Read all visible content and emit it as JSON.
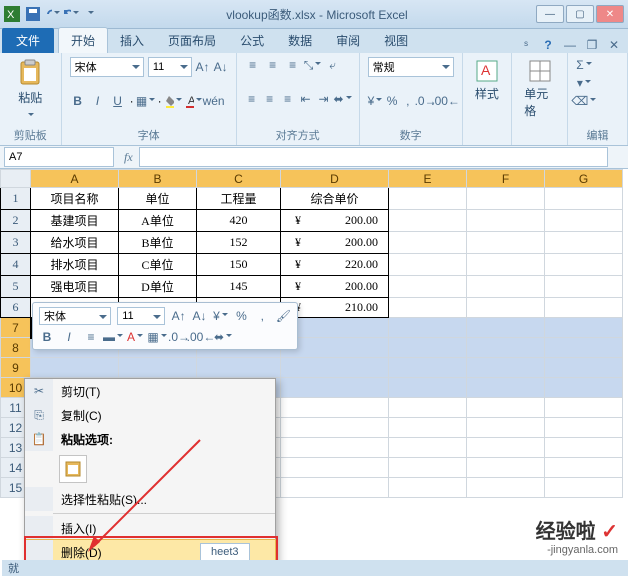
{
  "title": "vlookup函数.xlsx - Microsoft Excel",
  "tabs": {
    "file": "文件",
    "home": "开始",
    "insert": "插入",
    "layout": "页面布局",
    "formulas": "公式",
    "data": "数据",
    "review": "审阅",
    "view": "视图"
  },
  "ribbon": {
    "clipboard": {
      "paste": "粘贴",
      "label": "剪贴板"
    },
    "font": {
      "name": "宋体",
      "size": "11",
      "label": "字体"
    },
    "align": {
      "label": "对齐方式"
    },
    "number": {
      "format": "常规",
      "label": "数字"
    },
    "styles": {
      "btn": "样式",
      "label": ""
    },
    "cells": {
      "btn": "单元格",
      "label": ""
    },
    "editing": {
      "label": "编辑"
    }
  },
  "namebox": "A7",
  "columns": [
    "A",
    "B",
    "C",
    "D",
    "E",
    "F",
    "G"
  ],
  "header_row": [
    "项目名称",
    "单位",
    "工程量",
    "综合单价"
  ],
  "rows": [
    {
      "a": "基建项目",
      "b": "A单位",
      "c": "420",
      "d": "200.00"
    },
    {
      "a": "给水项目",
      "b": "B单位",
      "c": "152",
      "d": "200.00"
    },
    {
      "a": "排水项目",
      "b": "C单位",
      "c": "150",
      "d": "220.00"
    },
    {
      "a": "强电项目",
      "b": "D单位",
      "c": "145",
      "d": "200.00"
    },
    {
      "a": "",
      "b": "",
      "c": "",
      "d": "210.00"
    }
  ],
  "minitoolbar": {
    "font": "宋体",
    "size": "11"
  },
  "context": {
    "cut": "剪切(T)",
    "copy": "复制(C)",
    "paste_opts": "粘贴选项:",
    "paste_special": "选择性粘贴(S)...",
    "insert": "插入(I)",
    "delete": "删除(D)"
  },
  "sheets": {
    "s3": "heet3"
  },
  "status": "就",
  "watermark": {
    "brand": "经验啦",
    "url": "-jingyanla.com"
  }
}
